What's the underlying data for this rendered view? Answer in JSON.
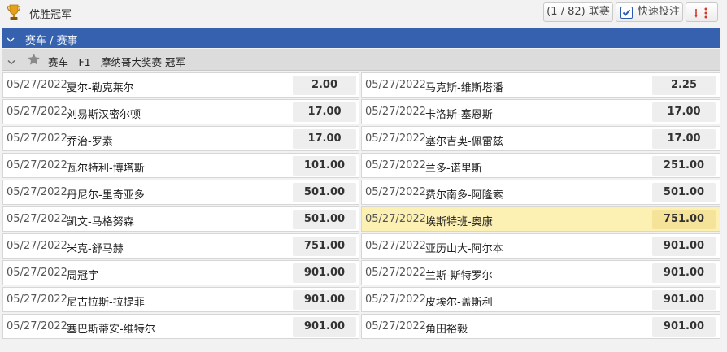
{
  "header": {
    "title": "优胜冠军",
    "match_count": "(1 / 82) 联赛",
    "quick_bet_label": "快速投注",
    "quick_bet_checked": true
  },
  "sport": {
    "label": "赛车 / 赛事"
  },
  "league": {
    "label": "赛车 - F1 - 摩纳哥大奖赛 冠军"
  },
  "rows": [
    {
      "left": {
        "date": "05/27/2022",
        "name": "夏尔-勒克莱尔",
        "odds": "2.00"
      },
      "right": {
        "date": "05/27/2022",
        "name": "马克斯-维斯塔潘",
        "odds": "2.25"
      }
    },
    {
      "left": {
        "date": "05/27/2022",
        "name": "刘易斯汉密尔顿",
        "odds": "17.00"
      },
      "right": {
        "date": "05/27/2022",
        "name": "卡洛斯-塞恩斯",
        "odds": "17.00"
      }
    },
    {
      "left": {
        "date": "05/27/2022",
        "name": "乔治-罗素",
        "odds": "17.00"
      },
      "right": {
        "date": "05/27/2022",
        "name": "塞尔吉奥-佩雷兹",
        "odds": "17.00"
      }
    },
    {
      "left": {
        "date": "05/27/2022",
        "name": "瓦尔特利-博塔斯",
        "odds": "101.00"
      },
      "right": {
        "date": "05/27/2022",
        "name": "兰多-诺里斯",
        "odds": "251.00"
      }
    },
    {
      "left": {
        "date": "05/27/2022",
        "name": "丹尼尔-里奇亚多",
        "odds": "501.00"
      },
      "right": {
        "date": "05/27/2022",
        "name": "费尔南多-阿隆索",
        "odds": "501.00"
      }
    },
    {
      "left": {
        "date": "05/27/2022",
        "name": "凯文-马格努森",
        "odds": "501.00"
      },
      "right": {
        "date": "05/27/2022",
        "name": "埃斯特班-奥康",
        "odds": "751.00",
        "highlight": true
      }
    },
    {
      "left": {
        "date": "05/27/2022",
        "name": "米克-舒马赫",
        "odds": "751.00"
      },
      "right": {
        "date": "05/27/2022",
        "name": "亚历山大-阿尔本",
        "odds": "901.00"
      }
    },
    {
      "left": {
        "date": "05/27/2022",
        "name": "周冠宇",
        "odds": "901.00"
      },
      "right": {
        "date": "05/27/2022",
        "name": "兰斯-斯特罗尔",
        "odds": "901.00"
      }
    },
    {
      "left": {
        "date": "05/27/2022",
        "name": "尼古拉斯-拉提菲",
        "odds": "901.00"
      },
      "right": {
        "date": "05/27/2022",
        "name": "皮埃尔-盖斯利",
        "odds": "901.00"
      }
    },
    {
      "left": {
        "date": "05/27/2022",
        "name": "塞巴斯蒂安-维特尔",
        "odds": "901.00"
      },
      "right": {
        "date": "05/27/2022",
        "name": "角田裕毅",
        "odds": "901.00"
      }
    }
  ],
  "icons": {
    "trophy": "trophy-icon",
    "checkbox": "checkbox-checked-icon",
    "sort": "sort-arrows-icon",
    "collapse": "chevron-down-icon",
    "favorite": "star-icon"
  },
  "colors": {
    "sport_header": "#3561ae",
    "league_header": "#dcdcdc",
    "highlight": "#fdf0b3",
    "sort_arrow": "#d9362b"
  }
}
